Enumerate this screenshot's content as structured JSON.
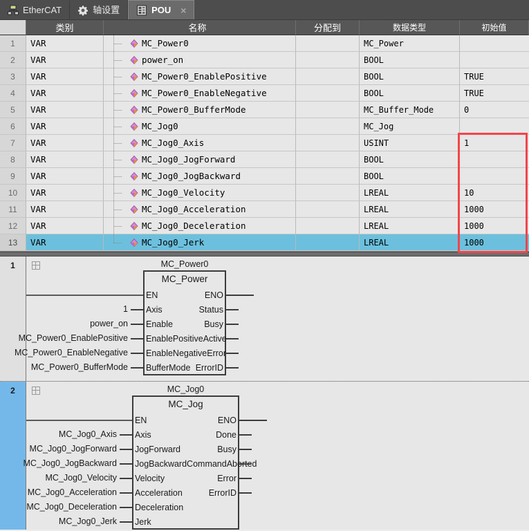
{
  "tabs": [
    {
      "label": "EtherCAT",
      "icon": "network-icon",
      "active": false,
      "closable": false
    },
    {
      "label": "轴设置",
      "icon": "gear-icon",
      "active": false,
      "closable": false
    },
    {
      "label": "POU",
      "icon": "document-icon",
      "active": true,
      "closable": true,
      "close_glyph": "×"
    }
  ],
  "var_table": {
    "headers": [
      "类别",
      "名称",
      "分配到",
      "数据类型",
      "初始值"
    ],
    "selected_row": 13,
    "rows": [
      {
        "num": "1",
        "class": "VAR",
        "name": "MC_Power0",
        "assigned": "",
        "type": "MC_Power",
        "init": ""
      },
      {
        "num": "2",
        "class": "VAR",
        "name": "power_on",
        "assigned": "",
        "type": "BOOL",
        "init": ""
      },
      {
        "num": "3",
        "class": "VAR",
        "name": "MC_Power0_EnablePositive",
        "assigned": "",
        "type": "BOOL",
        "init": "TRUE"
      },
      {
        "num": "4",
        "class": "VAR",
        "name": "MC_Power0_EnableNegative",
        "assigned": "",
        "type": "BOOL",
        "init": "TRUE"
      },
      {
        "num": "5",
        "class": "VAR",
        "name": "MC_Power0_BufferMode",
        "assigned": "",
        "type": "MC_Buffer_Mode",
        "init": "0"
      },
      {
        "num": "6",
        "class": "VAR",
        "name": "MC_Jog0",
        "assigned": "",
        "type": "MC_Jog",
        "init": ""
      },
      {
        "num": "7",
        "class": "VAR",
        "name": "MC_Jog0_Axis",
        "assigned": "",
        "type": "USINT",
        "init": "1"
      },
      {
        "num": "8",
        "class": "VAR",
        "name": "MC_Jog0_JogForward",
        "assigned": "",
        "type": "BOOL",
        "init": ""
      },
      {
        "num": "9",
        "class": "VAR",
        "name": "MC_Jog0_JogBackward",
        "assigned": "",
        "type": "BOOL",
        "init": ""
      },
      {
        "num": "10",
        "class": "VAR",
        "name": "MC_Jog0_Velocity",
        "assigned": "",
        "type": "LREAL",
        "init": "10"
      },
      {
        "num": "11",
        "class": "VAR",
        "name": "MC_Jog0_Acceleration",
        "assigned": "",
        "type": "LREAL",
        "init": "1000"
      },
      {
        "num": "12",
        "class": "VAR",
        "name": "MC_Jog0_Deceleration",
        "assigned": "",
        "type": "LREAL",
        "init": "1000"
      },
      {
        "num": "13",
        "class": "VAR",
        "name": "MC_Jog0_Jerk",
        "assigned": "",
        "type": "LREAL",
        "init": "1000"
      }
    ]
  },
  "annotation": {
    "highlight_color": "#f4444a",
    "target_column": "初始值",
    "from_row": "7",
    "to_row": "13"
  },
  "rungs": [
    {
      "number": "1",
      "selected": false,
      "instance_name": "MC_Power0",
      "block_type": "MC_Power",
      "inputs": [
        {
          "pin": "EN",
          "label": ""
        },
        {
          "pin": "Axis",
          "label": "1"
        },
        {
          "pin": "Enable",
          "label": "power_on"
        },
        {
          "pin": "EnablePositive",
          "label": "MC_Power0_EnablePositive"
        },
        {
          "pin": "EnableNegative",
          "label": "MC_Power0_EnableNegative"
        },
        {
          "pin": "BufferMode",
          "label": "MC_Power0_BufferMode"
        }
      ],
      "outputs": [
        {
          "pin": "ENO",
          "label": ""
        },
        {
          "pin": "Status",
          "label": ""
        },
        {
          "pin": "Busy",
          "label": ""
        },
        {
          "pin": "Active",
          "label": ""
        },
        {
          "pin": "Error",
          "label": ""
        },
        {
          "pin": "ErrorID",
          "label": ""
        }
      ]
    },
    {
      "number": "2",
      "selected": true,
      "instance_name": "MC_Jog0",
      "block_type": "MC_Jog",
      "inputs": [
        {
          "pin": "EN",
          "label": ""
        },
        {
          "pin": "Axis",
          "label": "MC_Jog0_Axis"
        },
        {
          "pin": "JogForward",
          "label": "MC_Jog0_JogForward"
        },
        {
          "pin": "JogBackward",
          "label": "MC_Jog0_JogBackward"
        },
        {
          "pin": "Velocity",
          "label": "MC_Jog0_Velocity"
        },
        {
          "pin": "Acceleration",
          "label": "MC_Jog0_Acceleration"
        },
        {
          "pin": "Deceleration",
          "label": "MC_Jog0_Deceleration"
        },
        {
          "pin": "Jerk",
          "label": "MC_Jog0_Jerk"
        }
      ],
      "outputs": [
        {
          "pin": "ENO",
          "label": ""
        },
        {
          "pin": "Done",
          "label": ""
        },
        {
          "pin": "Busy",
          "label": ""
        },
        {
          "pin": "CommandAborted",
          "label": ""
        },
        {
          "pin": "Error",
          "label": ""
        },
        {
          "pin": "ErrorID",
          "label": ""
        }
      ]
    }
  ],
  "colors": {
    "tabbar_bg": "#4d4d4d",
    "tab_active_bg": "#6b6b6b",
    "header_bg": "#575757",
    "grid_bg": "#e7e7e7",
    "row_selected": "#6cc0dd",
    "rung_selected": "#74b8ea",
    "annotation_red": "#f4444a"
  }
}
